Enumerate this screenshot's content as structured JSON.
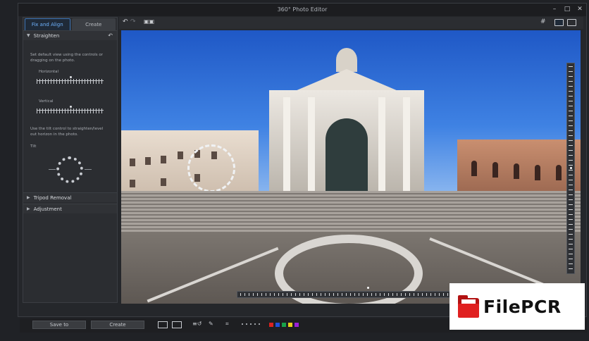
{
  "window": {
    "title": "360° Photo Editor"
  },
  "panel": {
    "tabs": [
      {
        "label": "Fix and Align",
        "active": true
      },
      {
        "label": "Create",
        "active": false
      }
    ],
    "straighten": {
      "title": "Straighten",
      "description": "Set default view using the controls or dragging on the photo.",
      "horizontal_label": "Horizontal",
      "vertical_label": "Vertical",
      "tilt_description": "Use the tilt control to straighten/level out horizon in the photo.",
      "tilt_label": "Tilt"
    },
    "tripod_removal": {
      "title": "Tripod Removal"
    },
    "adjustment": {
      "title": "Adjustment"
    }
  },
  "bottombar": {
    "save_label": "Save to",
    "create_label": "Create",
    "swatches": [
      "#d9231f",
      "#1f4fd9",
      "#17a34a",
      "#e6d11a",
      "#9b1fd9"
    ]
  },
  "watermark": {
    "text": "FilePCR"
  },
  "colors": {
    "accent": "#3d74b5",
    "panel": "#2b2d31"
  }
}
